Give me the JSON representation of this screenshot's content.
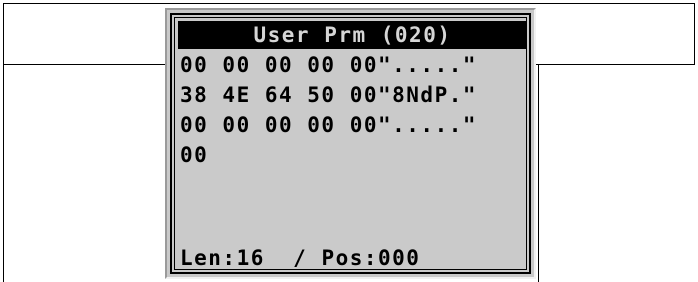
{
  "screen": {
    "title": "User Prm (020)",
    "lines": [
      "00 00 00 00 00\".....\"",
      "38 4E 64 50 00\"8NdP.\"",
      "00 00 00 00 00\".....\"",
      "00"
    ],
    "status": {
      "length": "Len:16",
      "position": "/ Pos:000"
    }
  },
  "colors": {
    "lcd_background": "#cacaca",
    "title_bar": "#000000",
    "title_text": "#d6d6d6",
    "text": "#000000"
  }
}
